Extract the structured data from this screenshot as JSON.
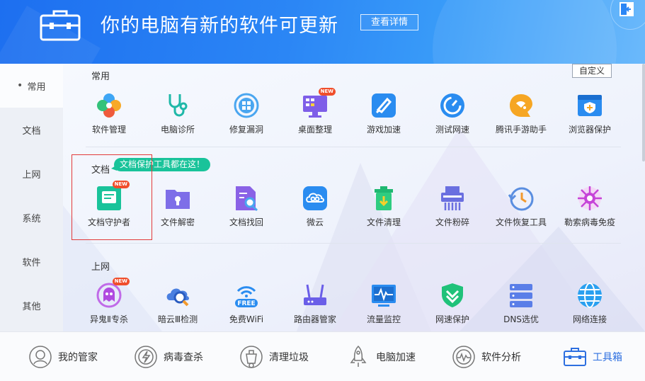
{
  "header": {
    "title": "你的电脑有新的软件可更新",
    "detail_button": "查看详情"
  },
  "sidebar": {
    "items": [
      {
        "label": "常用",
        "active": true
      },
      {
        "label": "文档"
      },
      {
        "label": "上网"
      },
      {
        "label": "系统"
      },
      {
        "label": "软件"
      },
      {
        "label": "其他"
      }
    ]
  },
  "main": {
    "customize_button": "自定义",
    "tooltip": "文档保护工具都在这！",
    "sections": [
      {
        "title": "常用",
        "tools": [
          {
            "label": "软件管理",
            "icon": "software-manager-icon"
          },
          {
            "label": "电脑诊所",
            "icon": "stethoscope-icon"
          },
          {
            "label": "修复漏洞",
            "icon": "repair-vulnerability-icon"
          },
          {
            "label": "桌面整理",
            "icon": "desktop-organizer-icon",
            "badge": "NEW"
          },
          {
            "label": "游戏加速",
            "icon": "game-accelerate-icon"
          },
          {
            "label": "测试网速",
            "icon": "speed-test-icon"
          },
          {
            "label": "腾讯手游助手",
            "icon": "mobile-game-assistant-icon"
          },
          {
            "label": "浏览器保护",
            "icon": "browser-protect-icon"
          }
        ]
      },
      {
        "title": "文档",
        "tools": [
          {
            "label": "文档守护者",
            "icon": "document-guardian-icon",
            "badge": "NEW"
          },
          {
            "label": "文件解密",
            "icon": "file-decrypt-icon"
          },
          {
            "label": "文档找回",
            "icon": "document-recover-icon"
          },
          {
            "label": "微云",
            "icon": "weiyun-icon"
          },
          {
            "label": "文件清理",
            "icon": "file-cleanup-icon"
          },
          {
            "label": "文件粉碎",
            "icon": "file-shredder-icon"
          },
          {
            "label": "文件恢复工具",
            "icon": "file-restore-icon"
          },
          {
            "label": "勒索病毒免疫",
            "icon": "ransomware-immune-icon"
          }
        ]
      },
      {
        "title": "上网",
        "tools": [
          {
            "label": "异鬼Ⅱ专杀",
            "icon": "ghost-killer-icon",
            "badge": "NEW"
          },
          {
            "label": "暗云Ⅲ检测",
            "icon": "dark-cloud-detect-icon"
          },
          {
            "label": "免费WiFi",
            "icon": "free-wifi-icon",
            "wifi_text": "FREE"
          },
          {
            "label": "路由器管家",
            "icon": "router-manager-icon"
          },
          {
            "label": "流量监控",
            "icon": "traffic-monitor-icon"
          },
          {
            "label": "网速保护",
            "icon": "net-speed-protect-icon"
          },
          {
            "label": "DNS选优",
            "icon": "dns-optimize-icon"
          },
          {
            "label": "网络连接",
            "icon": "network-connect-icon"
          }
        ]
      }
    ]
  },
  "bottom_nav": [
    {
      "label": "我的管家",
      "icon": "my-manager-icon"
    },
    {
      "label": "病毒查杀",
      "icon": "virus-scan-icon"
    },
    {
      "label": "清理垃圾",
      "icon": "cleanup-icon"
    },
    {
      "label": "电脑加速",
      "icon": "speedup-rocket-icon"
    },
    {
      "label": "软件分析",
      "icon": "software-analysis-icon"
    },
    {
      "label": "工具箱",
      "icon": "toolbox-icon",
      "active": true
    }
  ]
}
